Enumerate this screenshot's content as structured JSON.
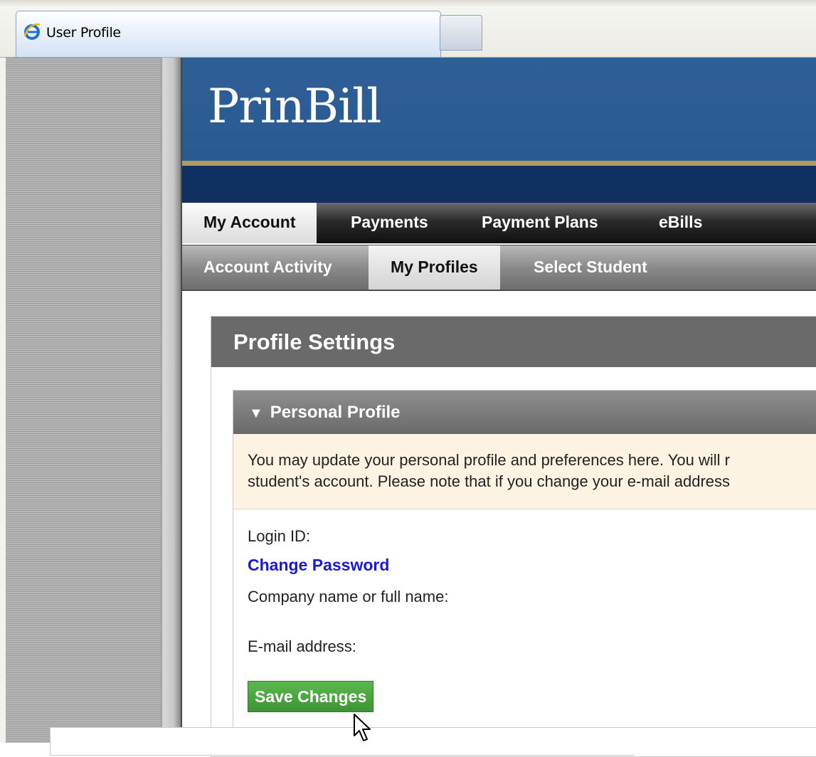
{
  "browser": {
    "tab_title": "User Profile",
    "tab_icon": "ie-icon"
  },
  "site": {
    "logo": "PrinBill",
    "brand_color": "#2f5f96",
    "accent_gold": "#b29b5e"
  },
  "nav_primary": {
    "items": [
      {
        "label": "My Account",
        "active": true
      },
      {
        "label": "Payments",
        "active": false
      },
      {
        "label": "Payment Plans",
        "active": false
      },
      {
        "label": "eBills",
        "active": false
      }
    ]
  },
  "nav_secondary": {
    "items": [
      {
        "label": "Account Activity",
        "active": false
      },
      {
        "label": "My Profiles",
        "active": true
      },
      {
        "label": "Select Student",
        "active": false
      }
    ]
  },
  "panel": {
    "title": "Profile Settings",
    "section": {
      "title": "Personal Profile",
      "expanded": true,
      "notice_line1": "You may update your personal profile and preferences here. You will r",
      "notice_line2": "student's account. Please note that if you change your e-mail address",
      "login_id_label": "Login ID:",
      "change_password_link": "Change Password",
      "name_label": "Company name or full name:",
      "email_label": "E-mail address:",
      "save_button": "Save Changes",
      "save_button_color": "#4aa63f"
    }
  }
}
